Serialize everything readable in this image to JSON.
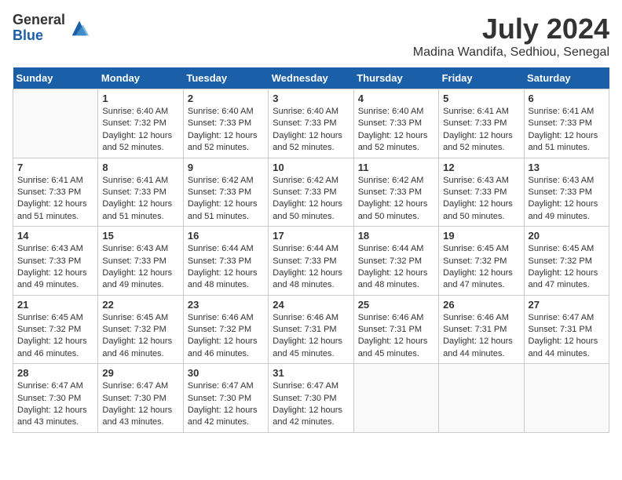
{
  "header": {
    "logo_general": "General",
    "logo_blue": "Blue",
    "month_title": "July 2024",
    "location": "Madina Wandifa, Sedhiou, Senegal"
  },
  "days_of_week": [
    "Sunday",
    "Monday",
    "Tuesday",
    "Wednesday",
    "Thursday",
    "Friday",
    "Saturday"
  ],
  "weeks": [
    [
      {
        "day": "",
        "info": ""
      },
      {
        "day": "1",
        "info": "Sunrise: 6:40 AM\nSunset: 7:32 PM\nDaylight: 12 hours and 52 minutes."
      },
      {
        "day": "2",
        "info": "Sunrise: 6:40 AM\nSunset: 7:33 PM\nDaylight: 12 hours and 52 minutes."
      },
      {
        "day": "3",
        "info": "Sunrise: 6:40 AM\nSunset: 7:33 PM\nDaylight: 12 hours and 52 minutes."
      },
      {
        "day": "4",
        "info": "Sunrise: 6:40 AM\nSunset: 7:33 PM\nDaylight: 12 hours and 52 minutes."
      },
      {
        "day": "5",
        "info": "Sunrise: 6:41 AM\nSunset: 7:33 PM\nDaylight: 12 hours and 52 minutes."
      },
      {
        "day": "6",
        "info": "Sunrise: 6:41 AM\nSunset: 7:33 PM\nDaylight: 12 hours and 51 minutes."
      }
    ],
    [
      {
        "day": "7",
        "info": "Sunrise: 6:41 AM\nSunset: 7:33 PM\nDaylight: 12 hours and 51 minutes."
      },
      {
        "day": "8",
        "info": "Sunrise: 6:41 AM\nSunset: 7:33 PM\nDaylight: 12 hours and 51 minutes."
      },
      {
        "day": "9",
        "info": "Sunrise: 6:42 AM\nSunset: 7:33 PM\nDaylight: 12 hours and 51 minutes."
      },
      {
        "day": "10",
        "info": "Sunrise: 6:42 AM\nSunset: 7:33 PM\nDaylight: 12 hours and 50 minutes."
      },
      {
        "day": "11",
        "info": "Sunrise: 6:42 AM\nSunset: 7:33 PM\nDaylight: 12 hours and 50 minutes."
      },
      {
        "day": "12",
        "info": "Sunrise: 6:43 AM\nSunset: 7:33 PM\nDaylight: 12 hours and 50 minutes."
      },
      {
        "day": "13",
        "info": "Sunrise: 6:43 AM\nSunset: 7:33 PM\nDaylight: 12 hours and 49 minutes."
      }
    ],
    [
      {
        "day": "14",
        "info": "Sunrise: 6:43 AM\nSunset: 7:33 PM\nDaylight: 12 hours and 49 minutes."
      },
      {
        "day": "15",
        "info": "Sunrise: 6:43 AM\nSunset: 7:33 PM\nDaylight: 12 hours and 49 minutes."
      },
      {
        "day": "16",
        "info": "Sunrise: 6:44 AM\nSunset: 7:33 PM\nDaylight: 12 hours and 48 minutes."
      },
      {
        "day": "17",
        "info": "Sunrise: 6:44 AM\nSunset: 7:33 PM\nDaylight: 12 hours and 48 minutes."
      },
      {
        "day": "18",
        "info": "Sunrise: 6:44 AM\nSunset: 7:32 PM\nDaylight: 12 hours and 48 minutes."
      },
      {
        "day": "19",
        "info": "Sunrise: 6:45 AM\nSunset: 7:32 PM\nDaylight: 12 hours and 47 minutes."
      },
      {
        "day": "20",
        "info": "Sunrise: 6:45 AM\nSunset: 7:32 PM\nDaylight: 12 hours and 47 minutes."
      }
    ],
    [
      {
        "day": "21",
        "info": "Sunrise: 6:45 AM\nSunset: 7:32 PM\nDaylight: 12 hours and 46 minutes."
      },
      {
        "day": "22",
        "info": "Sunrise: 6:45 AM\nSunset: 7:32 PM\nDaylight: 12 hours and 46 minutes."
      },
      {
        "day": "23",
        "info": "Sunrise: 6:46 AM\nSunset: 7:32 PM\nDaylight: 12 hours and 46 minutes."
      },
      {
        "day": "24",
        "info": "Sunrise: 6:46 AM\nSunset: 7:31 PM\nDaylight: 12 hours and 45 minutes."
      },
      {
        "day": "25",
        "info": "Sunrise: 6:46 AM\nSunset: 7:31 PM\nDaylight: 12 hours and 45 minutes."
      },
      {
        "day": "26",
        "info": "Sunrise: 6:46 AM\nSunset: 7:31 PM\nDaylight: 12 hours and 44 minutes."
      },
      {
        "day": "27",
        "info": "Sunrise: 6:47 AM\nSunset: 7:31 PM\nDaylight: 12 hours and 44 minutes."
      }
    ],
    [
      {
        "day": "28",
        "info": "Sunrise: 6:47 AM\nSunset: 7:30 PM\nDaylight: 12 hours and 43 minutes."
      },
      {
        "day": "29",
        "info": "Sunrise: 6:47 AM\nSunset: 7:30 PM\nDaylight: 12 hours and 43 minutes."
      },
      {
        "day": "30",
        "info": "Sunrise: 6:47 AM\nSunset: 7:30 PM\nDaylight: 12 hours and 42 minutes."
      },
      {
        "day": "31",
        "info": "Sunrise: 6:47 AM\nSunset: 7:30 PM\nDaylight: 12 hours and 42 minutes."
      },
      {
        "day": "",
        "info": ""
      },
      {
        "day": "",
        "info": ""
      },
      {
        "day": "",
        "info": ""
      }
    ]
  ]
}
